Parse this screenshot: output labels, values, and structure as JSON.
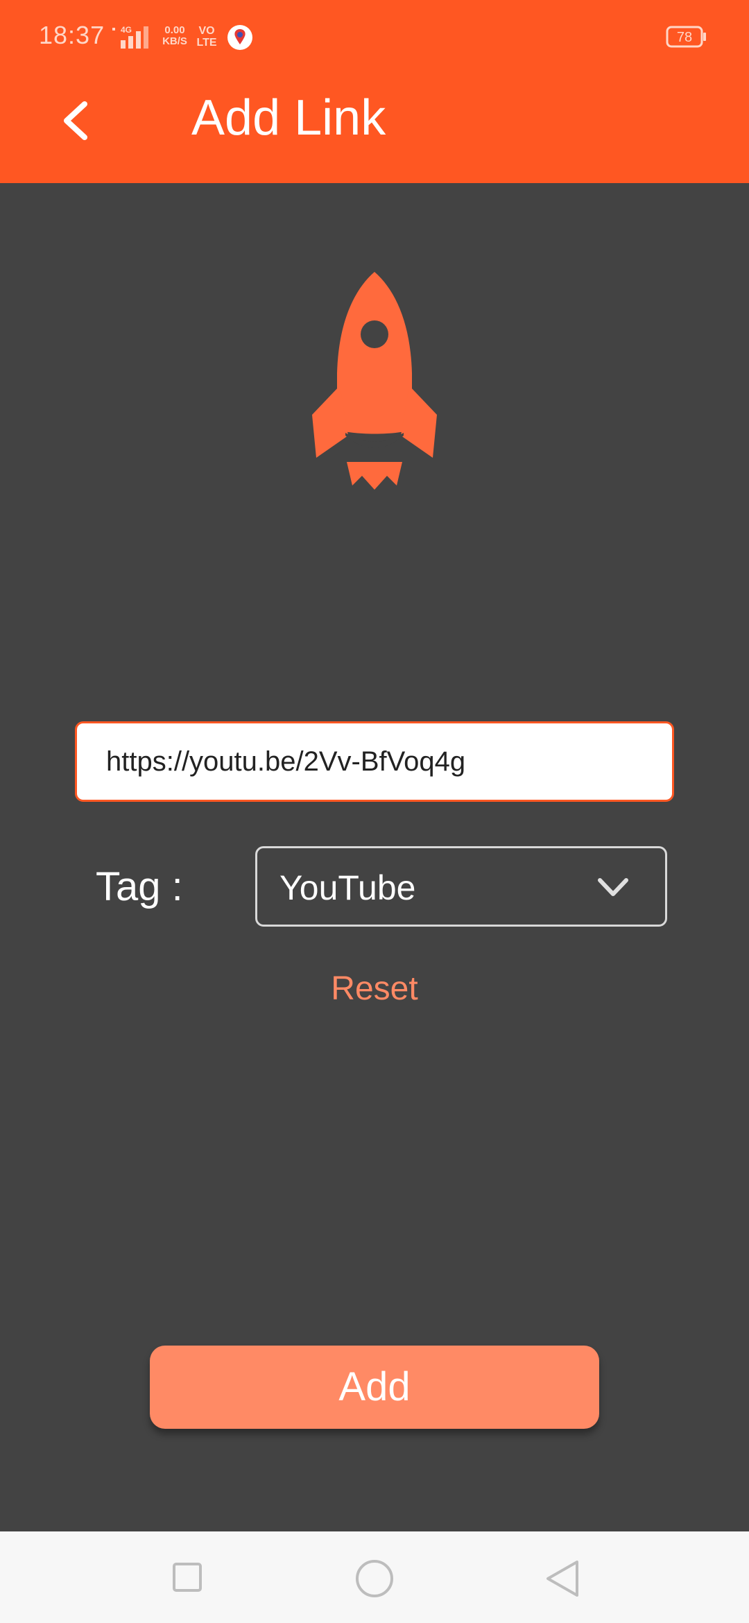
{
  "status_bar": {
    "time": "18:37",
    "network": "4G",
    "data_rate": "0.00",
    "data_unit": "KB/S",
    "volte_top": "VO",
    "volte_bottom": "LTE",
    "battery": "78"
  },
  "header": {
    "title": "Add Link",
    "back_icon": "chevron-left-icon",
    "bg_color": "#FF5722"
  },
  "main": {
    "hero_icon": "rocket-icon",
    "url_value": "https://youtu.be/2Vv-BfVoq4g",
    "tag_label": "Tag :",
    "tag_selected": "YouTube",
    "reset_label": "Reset",
    "add_label": "Add",
    "accent_color": "#FF8A65"
  },
  "nav_bar": {
    "recents_icon": "square-icon",
    "home_icon": "circle-icon",
    "back_icon": "triangle-back-icon"
  }
}
